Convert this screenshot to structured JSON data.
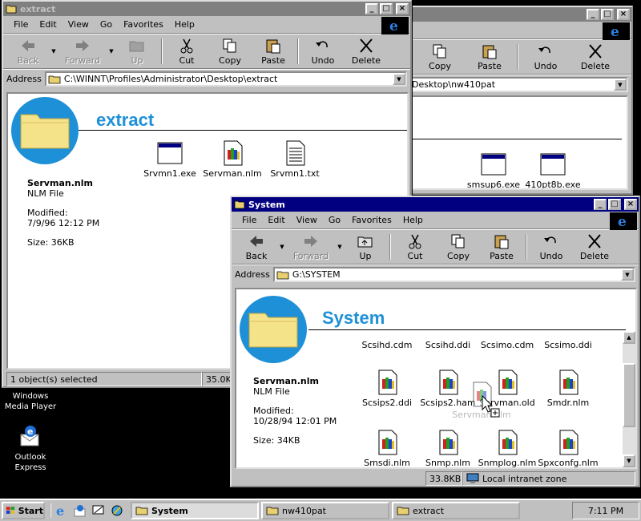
{
  "desktop": {
    "icons": [
      {
        "label": "Windows Media Player"
      },
      {
        "label": "Outlook Express"
      }
    ]
  },
  "menus": [
    "File",
    "Edit",
    "View",
    "Go",
    "Favorites",
    "Help"
  ],
  "toolbar": {
    "back": "Back",
    "forward": "Forward",
    "up": "Up",
    "cut": "Cut",
    "copy": "Copy",
    "paste": "Paste",
    "undo": "Undo",
    "delete": "Delete"
  },
  "address_label": "Address",
  "window_extract": {
    "title": "extract",
    "address": "C:\\WINNT\\Profiles\\Administrator\\Desktop\\extract",
    "view_title": "extract",
    "files": [
      "Srvmn1.exe",
      "Servman.nlm",
      "Srvmn1.txt"
    ],
    "info": {
      "name": "Servman.nlm",
      "type": "NLM File",
      "modified_label": "Modified:",
      "modified": "7/9/96 12:12 PM",
      "size": "Size: 36KB"
    },
    "status": {
      "selected": "1 object(s) selected",
      "size": "35.0KB"
    }
  },
  "window_nw410pat": {
    "title": "",
    "address": "Desktop\\nw410pat",
    "files": [
      "smsup6.exe",
      "410pt8b.exe"
    ]
  },
  "window_system": {
    "title": "System",
    "address": "G:\\SYSTEM",
    "view_title": "System",
    "info": {
      "name": "Servman.nlm",
      "type": "NLM File",
      "modified_label": "Modified:",
      "modified": "10/28/94 12:01 PM",
      "size": "Size: 34KB"
    },
    "top_row": [
      "Scsihd.cdm",
      "Scsihd.ddi",
      "Scsimo.cdm",
      "Scsimo.ddi"
    ],
    "row2": [
      "Scsips2.ddi",
      "Scsips2.ham",
      "Servman.old",
      "Smdr.nlm"
    ],
    "row3": [
      "Smsdi.nlm",
      "Snmp.nlm",
      "Snmplog.nlm",
      "Spxconfg.nlm"
    ],
    "drag_label": "Servman.nlm",
    "status": {
      "size": "33.8KB",
      "zone": "Local intranet zone"
    }
  },
  "taskbar": {
    "start": "Start",
    "tasks": [
      "System",
      "nw410pat",
      "extract"
    ],
    "clock": "7:11 PM"
  }
}
